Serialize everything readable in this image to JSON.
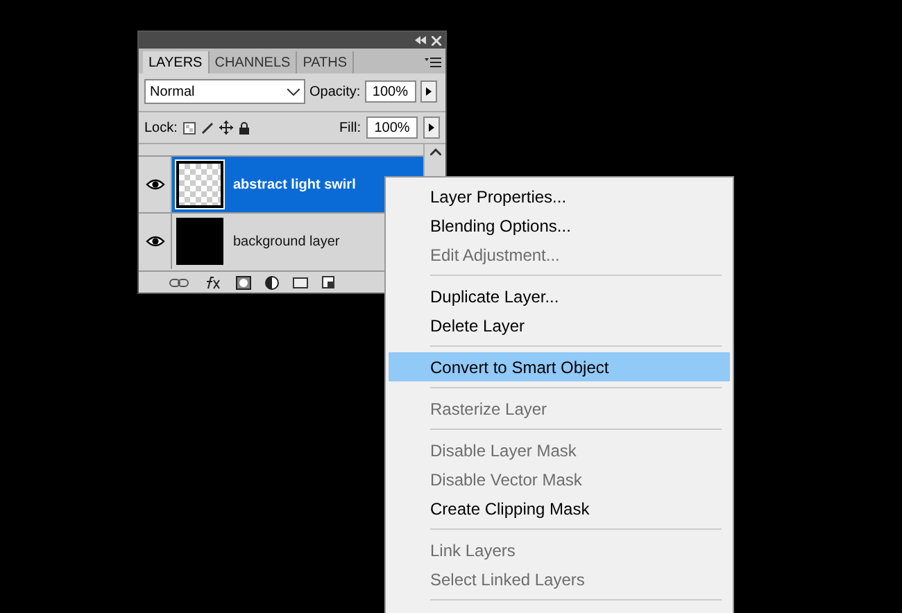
{
  "panel": {
    "tabs": [
      {
        "label": "LAYERS",
        "selected": true
      },
      {
        "label": "CHANNELS",
        "selected": false
      },
      {
        "label": "PATHS",
        "selected": false
      }
    ],
    "blend_mode": "Normal",
    "opacity_label": "Opacity:",
    "opacity": "100%",
    "lock_label": "Lock:",
    "fill_label": "Fill:",
    "fill": "100%",
    "layers": [
      {
        "name": "abstract light swirl",
        "selected": true,
        "visible": true,
        "kind": "transparent"
      },
      {
        "name": "background layer",
        "selected": false,
        "visible": true,
        "kind": "solid"
      }
    ]
  },
  "context_menu": [
    {
      "kind": "item",
      "label": "Layer Properties...",
      "disabled": false,
      "selected": false
    },
    {
      "kind": "item",
      "label": "Blending Options...",
      "disabled": false,
      "selected": false
    },
    {
      "kind": "item",
      "label": "Edit Adjustment...",
      "disabled": true,
      "selected": false
    },
    {
      "kind": "separator"
    },
    {
      "kind": "item",
      "label": "Duplicate Layer...",
      "disabled": false,
      "selected": false
    },
    {
      "kind": "item",
      "label": "Delete Layer",
      "disabled": false,
      "selected": false
    },
    {
      "kind": "separator"
    },
    {
      "kind": "item",
      "label": "Convert to Smart Object",
      "disabled": false,
      "selected": true
    },
    {
      "kind": "separator"
    },
    {
      "kind": "item",
      "label": "Rasterize Layer",
      "disabled": true,
      "selected": false
    },
    {
      "kind": "separator"
    },
    {
      "kind": "item",
      "label": "Disable Layer Mask",
      "disabled": true,
      "selected": false
    },
    {
      "kind": "item",
      "label": "Disable Vector Mask",
      "disabled": true,
      "selected": false
    },
    {
      "kind": "item",
      "label": "Create Clipping Mask",
      "disabled": false,
      "selected": false
    },
    {
      "kind": "separator"
    },
    {
      "kind": "item",
      "label": "Link Layers",
      "disabled": true,
      "selected": false
    },
    {
      "kind": "item",
      "label": "Select Linked Layers",
      "disabled": true,
      "selected": false
    },
    {
      "kind": "separator"
    }
  ]
}
